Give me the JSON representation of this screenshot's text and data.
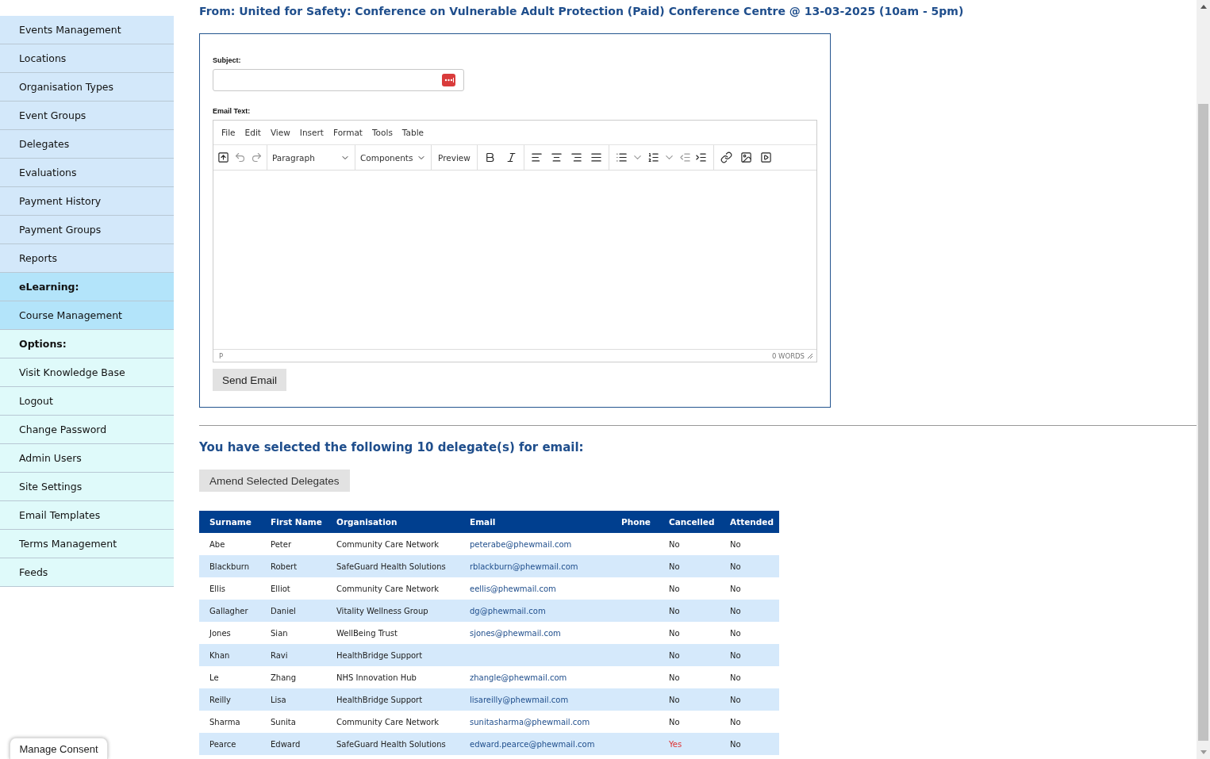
{
  "sidebar": {
    "sections": [
      {
        "color": "#d3e8fa",
        "items": [
          "Events Management",
          "Locations",
          "Organisation Types",
          "Event Groups",
          "Delegates",
          "Evaluations",
          "Payment History",
          "Payment Groups",
          "Reports"
        ]
      },
      {
        "title": "eLearning:",
        "color": "#b3e4fa",
        "items": [
          "Course Management"
        ]
      },
      {
        "title": "Options:",
        "color": "#dffafa",
        "items": [
          "Visit Knowledge Base",
          "Logout",
          "Change Password",
          "Admin Users",
          "Site Settings",
          "Email Templates",
          "Terms Management",
          "Feeds"
        ]
      }
    ]
  },
  "heading": "From: United for Safety: Conference on Vulnerable Adult Protection (Paid) Conference Centre @ 13-03-2025 (10am - 5pm)",
  "form": {
    "subject_label": "Subject:",
    "email_text_label": "Email Text:",
    "editor": {
      "menu": [
        "File",
        "Edit",
        "View",
        "Insert",
        "Format",
        "Tools",
        "Table"
      ],
      "block_format": "Paragraph",
      "components": "Components",
      "preview": "Preview",
      "path": "P",
      "word_count": "0 WORDS"
    },
    "send_button": "Send Email"
  },
  "selection_heading": "You have selected the following 10 delegate(s) for email:",
  "amend_button": "Amend Selected Delegates",
  "table": {
    "columns": [
      "Surname",
      "First Name",
      "Organisation",
      "Email",
      "Phone",
      "Cancelled",
      "Attended"
    ],
    "rows": [
      {
        "surname": "Abe",
        "first_name": "Peter",
        "organisation": "Community Care Network",
        "email": "peterabe@phewmail.com",
        "cancelled": "No",
        "is_cancelled": false,
        "attended": "No"
      },
      {
        "surname": "Blackburn",
        "first_name": "Robert",
        "organisation": "SafeGuard Health Solutions",
        "email": "rblackburn@phewmail.com",
        "cancelled": "No",
        "is_cancelled": false,
        "attended": "No"
      },
      {
        "surname": "Ellis",
        "first_name": "Elliot",
        "organisation": "Community Care Network",
        "email": "eellis@phewmail.com",
        "cancelled": "No",
        "is_cancelled": false,
        "attended": "No"
      },
      {
        "surname": "Gallagher",
        "first_name": "Daniel",
        "organisation": "Vitality Wellness Group",
        "email": "dg@phewmail.com",
        "cancelled": "No",
        "is_cancelled": false,
        "attended": "No"
      },
      {
        "surname": "Jones",
        "first_name": "Sian",
        "organisation": "WellBeing Trust",
        "email": "sjones@phewmail.com",
        "cancelled": "No",
        "is_cancelled": false,
        "attended": "No"
      },
      {
        "surname": "Khan",
        "first_name": "Ravi",
        "organisation": "HealthBridge Support",
        "cancelled": "No",
        "is_cancelled": false,
        "attended": "No"
      },
      {
        "surname": "Le",
        "first_name": "Zhang",
        "organisation": "NHS Innovation Hub",
        "email": "zhangle@phewmail.com",
        "cancelled": "No",
        "is_cancelled": false,
        "attended": "No"
      },
      {
        "surname": "Reilly",
        "first_name": "Lisa",
        "organisation": "HealthBridge Support",
        "email": "lisareilly@phewmail.com",
        "cancelled": "No",
        "is_cancelled": false,
        "attended": "No"
      },
      {
        "surname": "Sharma",
        "first_name": "Sunita",
        "organisation": "Community Care Network",
        "email": "sunitasharma@phewmail.com",
        "cancelled": "No",
        "is_cancelled": false,
        "attended": "No"
      },
      {
        "surname": "Pearce",
        "first_name": "Edward",
        "organisation": "SafeGuard Health Solutions",
        "email": "edward.pearce@phewmail.com",
        "cancelled": "Yes",
        "is_cancelled": true,
        "attended": "No"
      }
    ]
  },
  "consent_button": "Manage Consent"
}
